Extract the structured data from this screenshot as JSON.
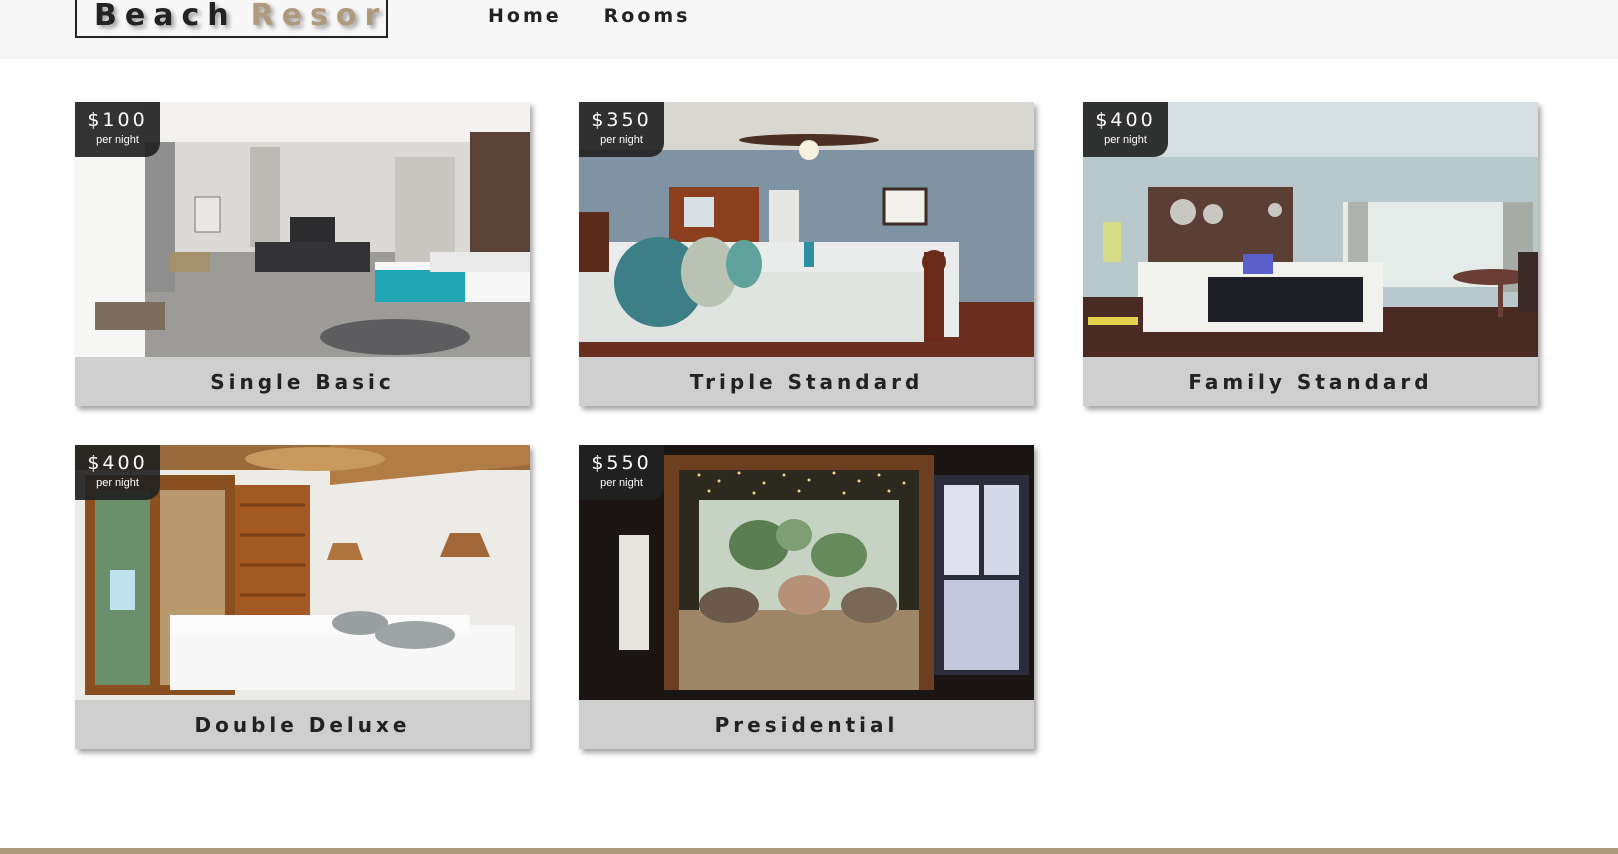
{
  "colors": {
    "primary": "#af9a7d",
    "dark": "#222222",
    "nav_bg": "#f7f7f7",
    "card_footer": "#cfcfcf"
  },
  "navbar": {
    "logo_word1": "Beach",
    "logo_word2": "Resort",
    "links": [
      {
        "label": "Home"
      },
      {
        "label": "Rooms"
      }
    ]
  },
  "rooms": [
    {
      "name": "Single Basic",
      "price": "$100",
      "price_unit": "per night",
      "image": "modern-white-bedroom-image"
    },
    {
      "name": "Triple Standard",
      "price": "$350",
      "price_unit": "per night",
      "image": "blue-wall-bedroom-image"
    },
    {
      "name": "Family Standard",
      "price": "$400",
      "price_unit": "per night",
      "image": "hotel-suite-bedroom-image"
    },
    {
      "name": "Double Deluxe",
      "price": "$400",
      "price_unit": "per night",
      "image": "tropical-wood-bedroom-image"
    },
    {
      "name": "Presidential",
      "price": "$550",
      "price_unit": "per night",
      "image": "canopy-bed-fairy-lights-image"
    }
  ]
}
